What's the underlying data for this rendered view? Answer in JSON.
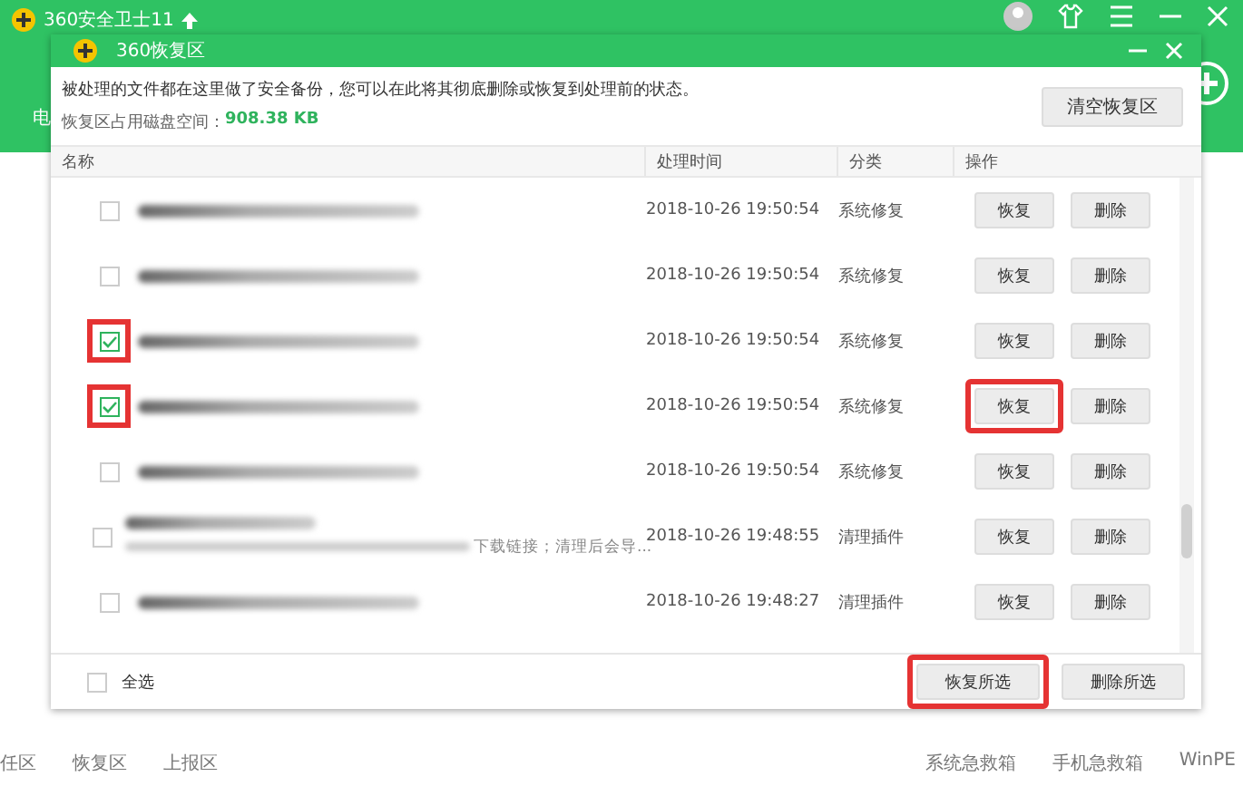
{
  "main_window": {
    "title": "360安全卫士11",
    "side_label": "电",
    "bottom_left": [
      "任区",
      "恢复区",
      "上报区"
    ],
    "bottom_right": [
      "系统急救箱",
      "手机急救箱",
      "WinPE"
    ]
  },
  "dialog": {
    "title": "360恢复区",
    "description": "被处理的文件都在这里做了安全备份，您可以在此将其彻底删除或恢复到处理前的状态。",
    "usage_label": "恢复区占用磁盘空间：",
    "usage_value": "908.38 KB",
    "clear_button": "清空恢复区"
  },
  "table": {
    "columns": [
      "名称",
      "处理时间",
      "分类",
      "操作"
    ],
    "rows": [
      {
        "checked": false,
        "highlight_check": false,
        "kind": "single",
        "time": "2018-10-26 19:50:54",
        "category": "系统修复",
        "restore": "恢复",
        "delete": "删除",
        "highlight_restore": false
      },
      {
        "checked": false,
        "highlight_check": false,
        "kind": "single",
        "time": "2018-10-26 19:50:54",
        "category": "系统修复",
        "restore": "恢复",
        "delete": "删除",
        "highlight_restore": false
      },
      {
        "checked": true,
        "highlight_check": true,
        "kind": "single",
        "time": "2018-10-26 19:50:54",
        "category": "系统修复",
        "restore": "恢复",
        "delete": "删除",
        "highlight_restore": false
      },
      {
        "checked": true,
        "highlight_check": true,
        "kind": "single",
        "time": "2018-10-26 19:50:54",
        "category": "系统修复",
        "restore": "恢复",
        "delete": "删除",
        "highlight_restore": true
      },
      {
        "checked": false,
        "highlight_check": false,
        "kind": "single",
        "time": "2018-10-26 19:50:54",
        "category": "系统修复",
        "restore": "恢复",
        "delete": "删除",
        "highlight_restore": false
      },
      {
        "checked": false,
        "highlight_check": false,
        "kind": "detail",
        "detail": "下载链接；清理后会导...",
        "time": "2018-10-26 19:48:55",
        "category": "清理插件",
        "restore": "恢复",
        "delete": "删除",
        "highlight_restore": false
      },
      {
        "checked": false,
        "highlight_check": false,
        "kind": "single",
        "time": "2018-10-26 19:48:27",
        "category": "清理插件",
        "restore": "恢复",
        "delete": "删除",
        "highlight_restore": false
      }
    ]
  },
  "footer": {
    "select_all": {
      "label": "全选",
      "checked": false
    },
    "restore_selected": {
      "label": "恢复所选",
      "highlighted": true
    },
    "delete_selected": {
      "label": "删除所选",
      "highlighted": false
    }
  }
}
